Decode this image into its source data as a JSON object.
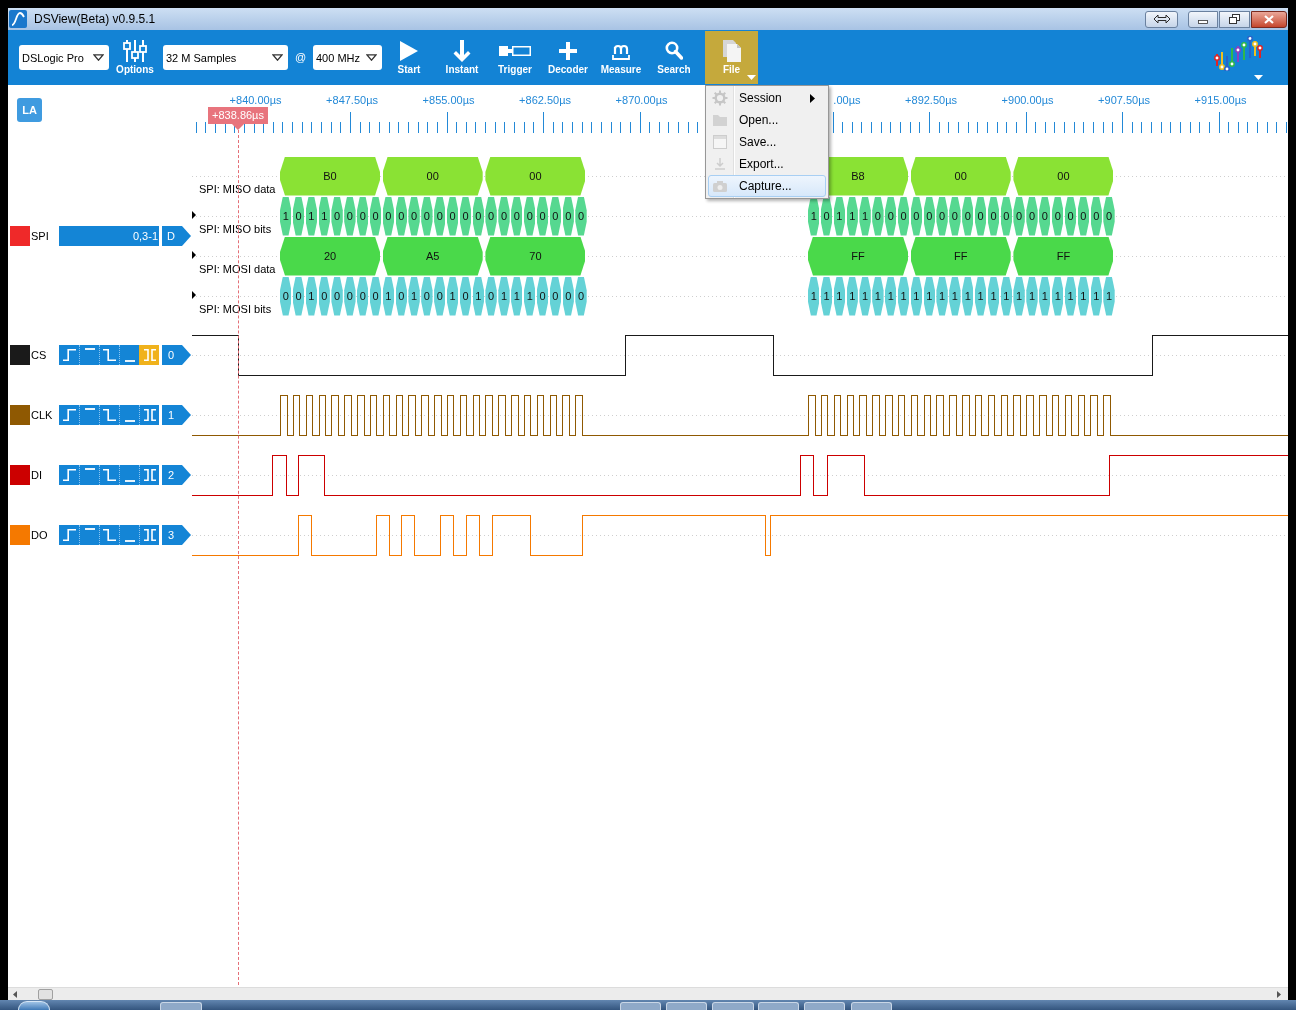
{
  "window": {
    "title": "DSView(Beta) v0.9.5.1"
  },
  "toolbar": {
    "device": {
      "value": "DSLogic Pro"
    },
    "options": {
      "label": "Options"
    },
    "samples": {
      "value": "32 M Samples"
    },
    "at": "@",
    "rate": {
      "value": "400 MHz"
    },
    "buttons": [
      {
        "kind": "start",
        "label": "Start",
        "selected": false
      },
      {
        "kind": "instant",
        "label": "Instant",
        "selected": false
      },
      {
        "kind": "trigger",
        "label": "Trigger",
        "selected": false
      },
      {
        "kind": "decoder",
        "label": "Decoder",
        "selected": false
      },
      {
        "kind": "measure",
        "label": "Measure",
        "selected": false
      },
      {
        "kind": "search",
        "label": "Search",
        "selected": false
      },
      {
        "kind": "file",
        "label": "File",
        "selected": true
      }
    ]
  },
  "file_menu": {
    "open": true,
    "items": [
      {
        "kind": "session",
        "label": "Session",
        "submenu": true,
        "selected": false
      },
      {
        "kind": "open",
        "label": "Open...",
        "submenu": false,
        "selected": false
      },
      {
        "kind": "save",
        "label": "Save...",
        "submenu": false,
        "selected": false
      },
      {
        "kind": "export",
        "label": "Export...",
        "submenu": false,
        "selected": false
      },
      {
        "kind": "capture",
        "label": "Capture...",
        "submenu": false,
        "selected": true
      }
    ]
  },
  "ruler": {
    "mode": "LA",
    "labels": [
      "+840.00µs",
      "+847.50µs",
      "+855.00µs",
      "+862.50µs",
      "+870.00µs",
      ".00µs",
      "+892.50µs",
      "+900.00µs",
      "+907.50µs",
      "+915.00µs"
    ],
    "cursor": "+838.86µs"
  },
  "signals": [
    {
      "kind": "decoder",
      "name": "SPI",
      "color": "#ef2929",
      "channels": "0,3-1",
      "tab": "D",
      "rows": [
        {
          "label": "SPI: MISO data",
          "kind": "data",
          "color": "#8ae234",
          "marker": false,
          "bursts": [
            [
              "B0",
              "00",
              "00"
            ],
            [
              "B8",
              "00",
              "00"
            ]
          ]
        },
        {
          "label": "SPI: MISO bits",
          "kind": "bits",
          "color": "#56d890",
          "marker": true,
          "bursts": [
            [
              "1",
              "0",
              "1",
              "1",
              "0",
              "0",
              "0",
              "0",
              "0",
              "0",
              "0",
              "0",
              "0",
              "0",
              "0",
              "0",
              "0",
              "0",
              "0",
              "0",
              "0",
              "0",
              "0",
              "0"
            ],
            [
              "1",
              "0",
              "1",
              "1",
              "1",
              "0",
              "0",
              "0",
              "0",
              "0",
              "0",
              "0",
              "0",
              "0",
              "0",
              "0",
              "0",
              "0",
              "0",
              "0",
              "0",
              "0",
              "0",
              "0"
            ]
          ]
        },
        {
          "label": "SPI: MOSI data",
          "kind": "data",
          "color": "#4ad94a",
          "marker": true,
          "bursts": [
            [
              "20",
              "A5",
              "70"
            ],
            [
              "FF",
              "FF",
              "FF"
            ]
          ]
        },
        {
          "label": "SPI: MOSI bits",
          "kind": "bits",
          "color": "#64d2d6",
          "marker": true,
          "bursts": [
            [
              "0",
              "0",
              "1",
              "0",
              "0",
              "0",
              "0",
              "0",
              "1",
              "0",
              "1",
              "0",
              "0",
              "1",
              "0",
              "1",
              "0",
              "1",
              "1",
              "1",
              "0",
              "0",
              "0",
              "0"
            ],
            [
              "1",
              "1",
              "1",
              "1",
              "1",
              "1",
              "1",
              "1",
              "1",
              "1",
              "1",
              "1",
              "1",
              "1",
              "1",
              "1",
              "1",
              "1",
              "1",
              "1",
              "1",
              "1",
              "1",
              "1"
            ]
          ]
        }
      ]
    },
    {
      "kind": "logic",
      "name": "CS",
      "color": "#1a1a1a",
      "index": "0",
      "triggers": [
        {
          "kind": "rising",
          "selected": false
        },
        {
          "kind": "high",
          "selected": false
        },
        {
          "kind": "falling",
          "selected": false
        },
        {
          "kind": "low",
          "selected": false
        },
        {
          "kind": "either",
          "selected": true
        }
      ]
    },
    {
      "kind": "logic",
      "name": "CLK",
      "color": "#8f5902",
      "index": "1",
      "triggers": [
        {
          "kind": "rising",
          "selected": false
        },
        {
          "kind": "high",
          "selected": false
        },
        {
          "kind": "falling",
          "selected": false
        },
        {
          "kind": "low",
          "selected": false
        },
        {
          "kind": "either",
          "selected": false
        }
      ]
    },
    {
      "kind": "logic",
      "name": "DI",
      "color": "#cc0000",
      "index": "2",
      "triggers": [
        {
          "kind": "rising",
          "selected": false
        },
        {
          "kind": "high",
          "selected": false
        },
        {
          "kind": "falling",
          "selected": false
        },
        {
          "kind": "low",
          "selected": false
        },
        {
          "kind": "either",
          "selected": false
        }
      ]
    },
    {
      "kind": "logic",
      "name": "DO",
      "color": "#f57900",
      "index": "3",
      "triggers": [
        {
          "kind": "rising",
          "selected": false
        },
        {
          "kind": "high",
          "selected": false
        },
        {
          "kind": "falling",
          "selected": false
        },
        {
          "kind": "low",
          "selected": false
        },
        {
          "kind": "either",
          "selected": false
        }
      ]
    }
  ]
}
